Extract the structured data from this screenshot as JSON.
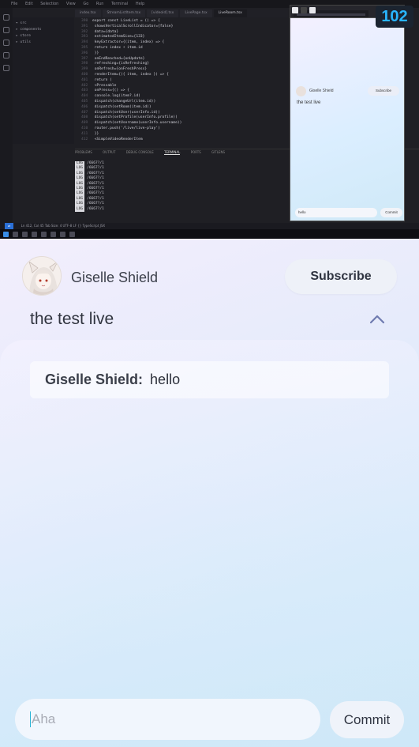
{
  "viewer_count": "102",
  "ide": {
    "title_menu": [
      "File",
      "Edit",
      "Selection",
      "View",
      "Go",
      "Run",
      "Terminal",
      "Help"
    ],
    "tabs": [
      "index.tsx",
      "StreamListItem.tsx",
      "[videoId].tsx",
      "LivePage.tsx",
      "LiveRoom.tsx"
    ],
    "code_lines": [
      "export const LiveList = () => {",
      "  showsVerticalScrollIndicator={false}",
      "  data={data}",
      "  estimatedItemSize={133}",
      "  keyExtractor={(item, index) => {",
      "    return index + item.id",
      "  }}",
      "  onEndReached={onUpdate}",
      "  refreshing={isRefreshing}",
      "  onRefresh={onFreshPress}",
      "  renderItem={({ item, index }) => {",
      "    return (",
      "      <Pressable",
      "        onPress={() => {",
      "          console.log(item?.id)",
      "          dispatch(changeUrl(item.id))",
      "          dispatch(setRoom(item.id))",
      "          dispatch(setUser(userInfo.id))",
      "          dispatch(setProfile(userInfo.profile))",
      "          dispatch(setUsername(userInfo.username))",
      "          router.push('/live/live-play')",
      "        }}",
      "        <SimpleVideoRenderItem"
    ],
    "panel_tabs": [
      "PROBLEMS",
      "OUTPUT",
      "DEBUG CONSOLE",
      "TERMINAL",
      "PORTS",
      "GITLENS"
    ],
    "terminal_tag": "LOG",
    "terminal_lines": [
      "/6667?/1",
      "/6667?/1",
      "/6667?/1",
      "/6667?/1",
      "/6667?/1",
      "/6667?/1",
      "/6667?/1",
      "/6667?/1",
      "/6667?/1",
      "/6667?/1"
    ],
    "status_text": "Ln 412, Col 45   Tab Size: 4   UTF-8   LF   {} TypeScript JSX"
  },
  "mini_phone": {
    "host_name": "Giselle Shield",
    "subscribe_label": "Subscribe",
    "title": "the test live",
    "input_value": "hello",
    "commit_label": "Commit"
  },
  "room": {
    "host_name": "Giselle Shield",
    "subscribe_label": "Subscribe",
    "live_title": "the test live",
    "messages": [
      {
        "user": "Giselle Shield:",
        "text": "hello"
      }
    ],
    "input": {
      "placeholder": "Aha",
      "value": ""
    },
    "commit_label": "Commit"
  },
  "colors": {
    "accent_cyan": "#29b6ff",
    "caret": "#2bb5d6",
    "text_primary": "#2c303b"
  },
  "icons": {
    "collapse": "chevron-up-icon",
    "avatar": "avatar-illustration"
  }
}
